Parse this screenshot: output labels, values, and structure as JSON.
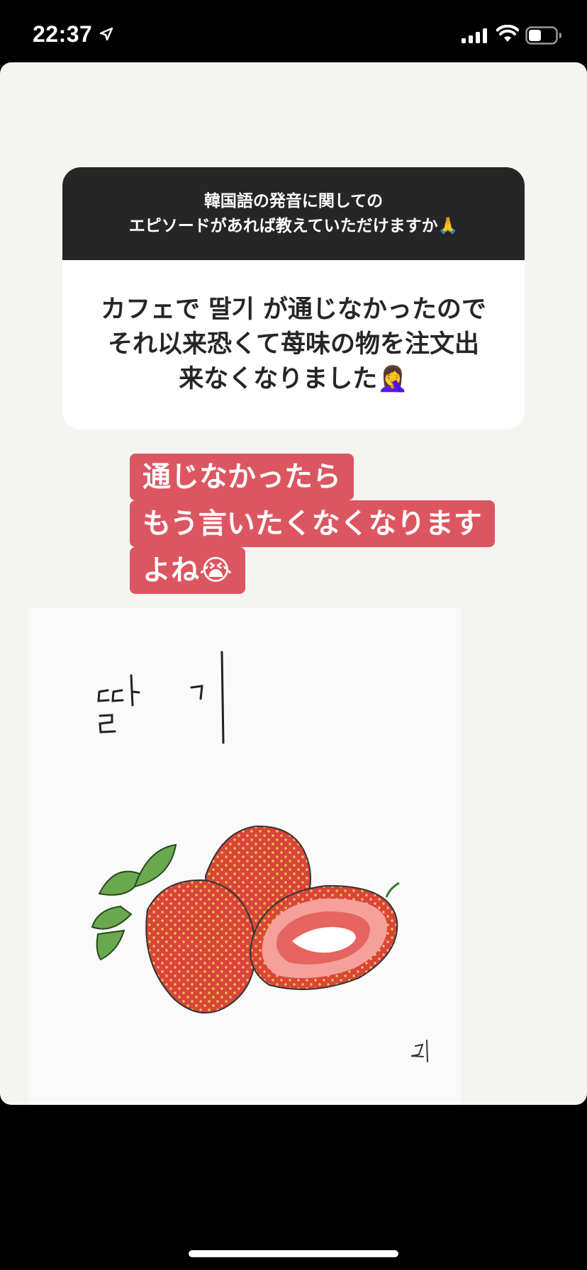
{
  "status_bar": {
    "time": "22:37",
    "icons": [
      "location-arrow-icon",
      "cellular-signal-icon",
      "wifi-icon",
      "battery-icon"
    ]
  },
  "question_sticker": {
    "question_lines": [
      "韓国語の発音に関しての",
      "エピソードがあれば教えていただけますか🙏"
    ],
    "answer_lines": [
      "カフェで 딸기 が通じなかったので",
      "それ以来恐くて苺味の物を注文出",
      "来なくなりました🤦‍♀️"
    ]
  },
  "caption": {
    "lines": [
      "通じなかったら",
      "もう言いたくなくなります",
      "よね😭"
    ]
  },
  "illustration": {
    "text": "딸 기",
    "signature": "리"
  },
  "colors": {
    "caption_bg": "#dc5661",
    "question_bg": "#262626",
    "card_bg": "#f4f4f1",
    "strawberry": "#d9453c",
    "seed": "#f2c94c",
    "leaf": "#6aa84f"
  }
}
